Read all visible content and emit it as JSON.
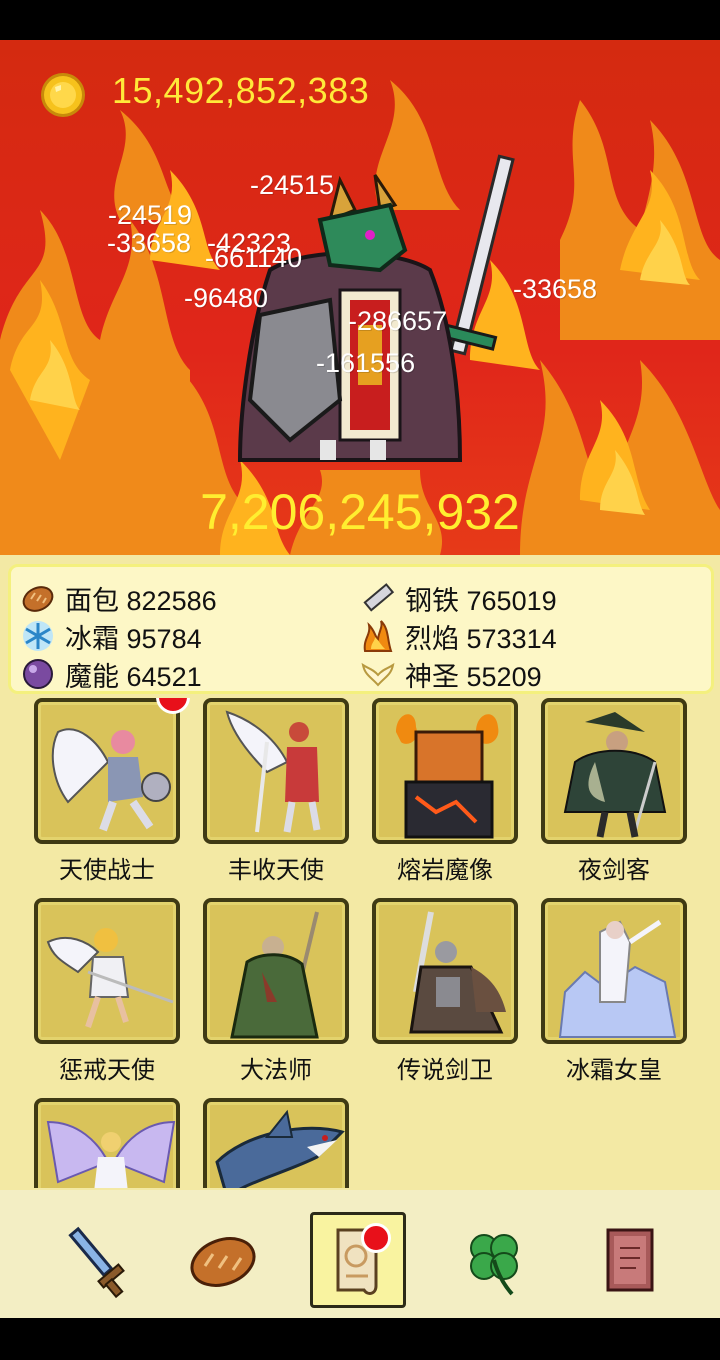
{
  "currency": {
    "gold": "15,492,852,383",
    "icon": "gold-coin-icon"
  },
  "boss": {
    "hp": "7,206,245,932",
    "icon": "dragon-knight-boss"
  },
  "damage_numbers": [
    "-24515",
    "-24519",
    "-33658",
    "-42323",
    "-661140",
    "-96480",
    "-286657",
    "-33658",
    "-161556"
  ],
  "resources": [
    {
      "icon": "bread-icon",
      "label": "面包",
      "value": "822586"
    },
    {
      "icon": "steel-icon",
      "label": "钢铁",
      "value": "765019"
    },
    {
      "icon": "frost-icon",
      "label": "冰霜",
      "value": "95784"
    },
    {
      "icon": "flame-icon",
      "label": "烈焰",
      "value": "573314"
    },
    {
      "icon": "magic-orb-icon",
      "label": "魔能",
      "value": "64521"
    },
    {
      "icon": "holy-wings-icon",
      "label": "神圣",
      "value": "55209"
    }
  ],
  "heroes": [
    {
      "name": "天使战士",
      "badge": true
    },
    {
      "name": "丰收天使",
      "badge": false
    },
    {
      "name": "熔岩魔像",
      "badge": false
    },
    {
      "name": "夜剑客",
      "badge": false
    },
    {
      "name": "惩戒天使",
      "badge": false
    },
    {
      "name": "大法师",
      "badge": false
    },
    {
      "name": "传说剑卫",
      "badge": false
    },
    {
      "name": "冰霜女皇",
      "badge": false
    },
    {
      "name": "",
      "badge": false
    },
    {
      "name": "",
      "badge": false
    }
  ],
  "nav": [
    {
      "icon": "sword-icon",
      "active": false,
      "badge": false
    },
    {
      "icon": "bread-icon",
      "active": false,
      "badge": false
    },
    {
      "icon": "scroll-icon",
      "active": true,
      "badge": true
    },
    {
      "icon": "clover-icon",
      "active": false,
      "badge": false
    },
    {
      "icon": "book-icon",
      "active": false,
      "badge": false
    }
  ],
  "colors": {
    "gold_text": "#ffe93a",
    "hp_text": "#ffee30",
    "panel_bg": "#f3e9a4",
    "badge": "#e8101a"
  }
}
